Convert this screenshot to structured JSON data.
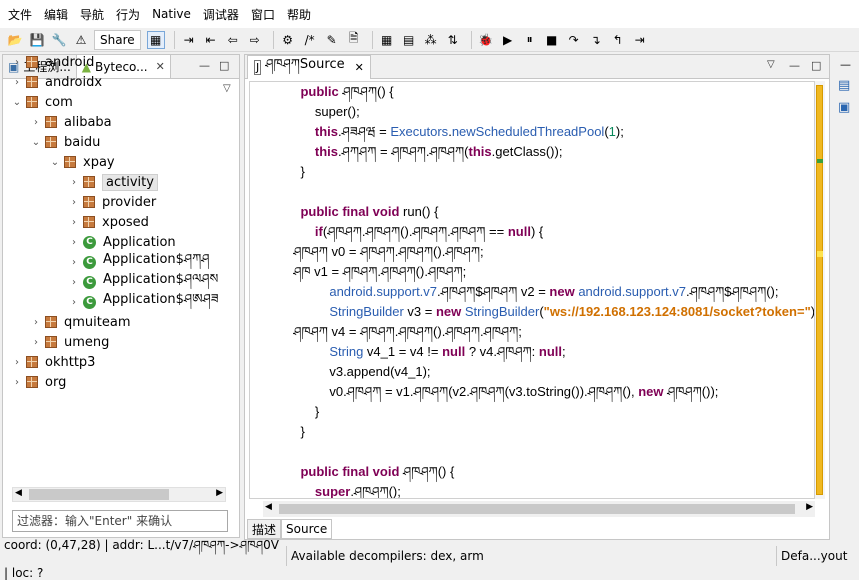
{
  "menu": [
    "文件",
    "编辑",
    "导航",
    "行为",
    "Native",
    "调试器",
    "窗口",
    "帮助"
  ],
  "toolbar": {
    "share_label": "Share"
  },
  "left_panel": {
    "tab_project": "工程浏...",
    "tab_bytecode": "Byteco...",
    "tree": [
      {
        "label": "android",
        "level": 0,
        "state": "collapsed",
        "kind": "package"
      },
      {
        "label": "androidx",
        "level": 0,
        "state": "collapsed",
        "kind": "package"
      },
      {
        "label": "com",
        "level": 0,
        "state": "expanded",
        "kind": "package"
      },
      {
        "label": "alibaba",
        "level": 1,
        "state": "collapsed",
        "kind": "package"
      },
      {
        "label": "baidu",
        "level": 1,
        "state": "expanded",
        "kind": "package"
      },
      {
        "label": "xpay",
        "level": 2,
        "state": "expanded",
        "kind": "package"
      },
      {
        "label": "activity",
        "level": 3,
        "state": "collapsed",
        "kind": "package",
        "selected": true
      },
      {
        "label": "provider",
        "level": 3,
        "state": "collapsed",
        "kind": "package"
      },
      {
        "label": "xposed",
        "level": 3,
        "state": "collapsed",
        "kind": "package"
      },
      {
        "label": "Application",
        "level": 3,
        "state": "collapsed",
        "kind": "class"
      },
      {
        "label": "Application$ཤཀཤ",
        "level": 3,
        "state": "collapsed",
        "kind": "class"
      },
      {
        "label": "Application$ཤལཤས",
        "level": 3,
        "state": "collapsed",
        "kind": "class"
      },
      {
        "label": "Application$ཤཨཤཟ",
        "level": 3,
        "state": "collapsed",
        "kind": "class"
      },
      {
        "label": "qmuiteam",
        "level": 1,
        "state": "collapsed",
        "kind": "package"
      },
      {
        "label": "umeng",
        "level": 1,
        "state": "collapsed",
        "kind": "package"
      },
      {
        "label": "okhttp3",
        "level": 0,
        "state": "collapsed",
        "kind": "package"
      },
      {
        "label": "org",
        "level": 0,
        "state": "collapsed",
        "kind": "package"
      }
    ],
    "filter_placeholder": "过滤器：输入\"Enter\" 来确认"
  },
  "editor": {
    "tab_label": "ཤཁཤཀSource",
    "code": [
      [
        [
          "t",
          "    "
        ],
        [
          "kw",
          "public"
        ],
        [
          "t",
          " ཤཁཤཀ() {"
        ]
      ],
      [
        [
          "t",
          "        super();"
        ]
      ],
      [
        [
          "t",
          "        "
        ],
        [
          "kw",
          "this"
        ],
        [
          "t",
          ".ཤཟཤཝ = "
        ],
        [
          "ty",
          "Executors"
        ],
        [
          "t",
          "."
        ],
        [
          "ty",
          "newScheduledThreadPool"
        ],
        [
          "t",
          "("
        ],
        [
          "num",
          "1"
        ],
        [
          "t",
          ");"
        ]
      ],
      [
        [
          "t",
          "        "
        ],
        [
          "kw",
          "this"
        ],
        [
          "t",
          ".ཤཀཤཀ = ཤཁཤཀ.ཤཁཤཀ("
        ],
        [
          "kw",
          "this"
        ],
        [
          "t",
          ".getClass());"
        ]
      ],
      [
        [
          "t",
          "    }"
        ]
      ],
      [
        [
          "t",
          ""
        ]
      ],
      [
        [
          "kw",
          "    public final void"
        ],
        [
          "t",
          " run() {"
        ]
      ],
      [
        [
          "t",
          "        "
        ],
        [
          "kw",
          "if"
        ],
        [
          "t",
          "(ཤཁཤཀ.ཤཁཤཀ().ཤཁཤཀ.ཤཁཤཀ == "
        ],
        [
          "kw",
          "null"
        ],
        [
          "t",
          ") {"
        ]
      ],
      [
        [
          "t",
          "  ཤཁཤཀ v0 = ཤཁཤཀ.ཤཁཤཀ().ཤཁཤཀ;"
        ]
      ],
      [
        [
          "t",
          "  ཤཁ v1 = ཤཁཤཀ.ཤཁཤཀ().ཤཁཤཀ;"
        ]
      ],
      [
        [
          "t",
          "            "
        ],
        [
          "ty",
          "android.support.v7"
        ],
        [
          "t",
          ".ཤཁཤཀ$ཤཁཤཀ v2 = "
        ],
        [
          "kw",
          "new"
        ],
        [
          "t",
          " "
        ],
        [
          "ty",
          "android.support.v7"
        ],
        [
          "t",
          ".ཤཁཤཀ$ཤཁཤཀ();"
        ]
      ],
      [
        [
          "t",
          "            "
        ],
        [
          "ty",
          "StringBuilder"
        ],
        [
          "t",
          " v3 = "
        ],
        [
          "kw",
          "new"
        ],
        [
          "t",
          " "
        ],
        [
          "ty",
          "StringBuilder"
        ],
        [
          "t",
          "("
        ],
        [
          "str",
          "\"ws://192.168.123.124:8081/socket?token=\""
        ],
        [
          "t",
          ");"
        ]
      ],
      [
        [
          "t",
          "  ཤཁཤཀ v4 = ཤཁཤཀ.ཤཁཤཀ().ཤཁཤཀ.ཤཁཤཀ;"
        ]
      ],
      [
        [
          "t",
          "            "
        ],
        [
          "ty",
          "String"
        ],
        [
          "t",
          " v4_1 = v4 != "
        ],
        [
          "kw",
          "null"
        ],
        [
          "t",
          " ? v4.ཤཁཤཀ: "
        ],
        [
          "kw",
          "null"
        ],
        [
          "t",
          ";"
        ]
      ],
      [
        [
          "t",
          "            v3.append(v4_1);"
        ]
      ],
      [
        [
          "t",
          "            v0.ཤཁཤཀ = v1.ཤཁཤཀ(v2.ཤཁཤཀ(v3.toString()).ཤཁཤཀ(), "
        ],
        [
          "kw",
          "new"
        ],
        [
          "t",
          " ཤཁཤཀ());"
        ]
      ],
      [
        [
          "t",
          "        }"
        ]
      ],
      [
        [
          "t",
          "    }"
        ]
      ],
      [
        [
          "t",
          ""
        ]
      ],
      [
        [
          "kw",
          "    public final void"
        ],
        [
          "t",
          " ཤཁཤཀ() {"
        ]
      ],
      [
        [
          "t",
          "        "
        ],
        [
          "kw",
          "super"
        ],
        [
          "t",
          ".ཤཁཤཀ();"
        ]
      ]
    ],
    "bottom_tabs": [
      "描述",
      "Source"
    ]
  },
  "status": {
    "coord": "coord: (0,47,28) | addr: L...t/v7/ཤཁཤཀ->ཤཁཤ0V | loc: ?",
    "decompilers": "Available decompilers: dex, arm",
    "layout": "Defa...yout"
  }
}
